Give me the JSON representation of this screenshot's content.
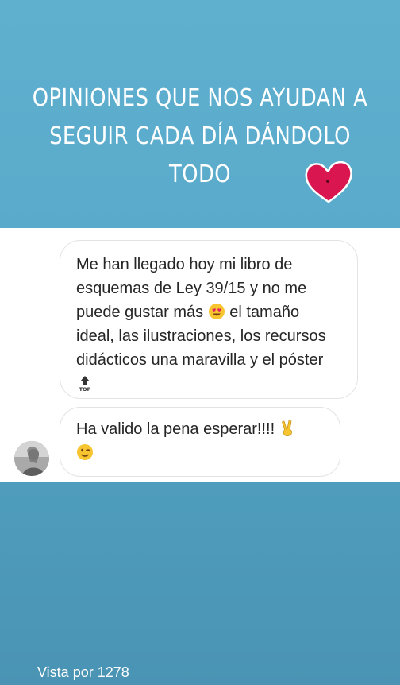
{
  "story": {
    "headline_line1": "OPINIONES QUE NOS AYUDAN A",
    "headline_line2": "SEGUIR CADA DÍA DÁNDOLO TODO",
    "background_color": "#5aaacb",
    "heart_color": "#d9164f"
  },
  "messages": [
    {
      "text_a": "Me han llegado hoy mi libro de esquemas de Ley 39/15 y no me puede gustar más",
      "emoji_a": "heart-eyes-emoji",
      "text_b": "el tamaño ideal, las ilustraciones, los recursos didácticos una maravilla y el póster",
      "emoji_b": "top-arrow-emoji"
    },
    {
      "text_a": "Ha valido la pena esperar!!!!",
      "emoji_a": "victory-hand-emoji",
      "emoji_b": "winking-face-emoji"
    }
  ],
  "footer": {
    "views_label": "Vista por 1278"
  }
}
